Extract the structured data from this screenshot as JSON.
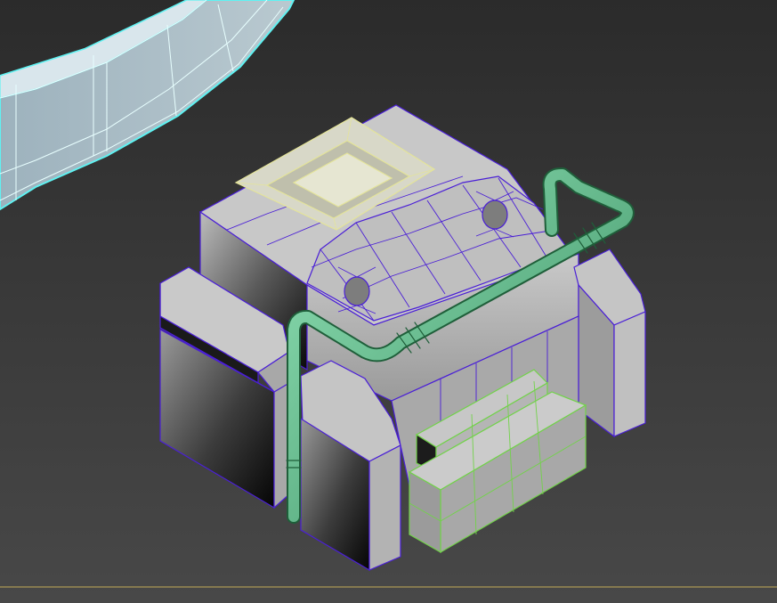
{
  "viewport": {
    "view": "perspective",
    "shading": "shaded-with-wireframe-edges",
    "background": "#3a3a3a",
    "ground_line_color": "#9a8a52"
  },
  "objects": [
    {
      "name": "curved-wall-segment",
      "selected": true,
      "wire_color": "#5ff2f2",
      "fill": "#9fb4bf"
    },
    {
      "name": "main-building-block",
      "selected": false,
      "wire_color": "#4a1fd6",
      "fill": "#9d9d9d"
    },
    {
      "name": "roof-hatch",
      "selected": false,
      "wire_color": "#e4e49a",
      "fill": "#cfcfb8"
    },
    {
      "name": "pipe",
      "selected": false,
      "wire_color": "#1f5f3a",
      "fill": "#5ab88a"
    },
    {
      "name": "front-bench",
      "selected": false,
      "wire_color": "#72d24a",
      "fill": "#a7a7a7"
    }
  ]
}
